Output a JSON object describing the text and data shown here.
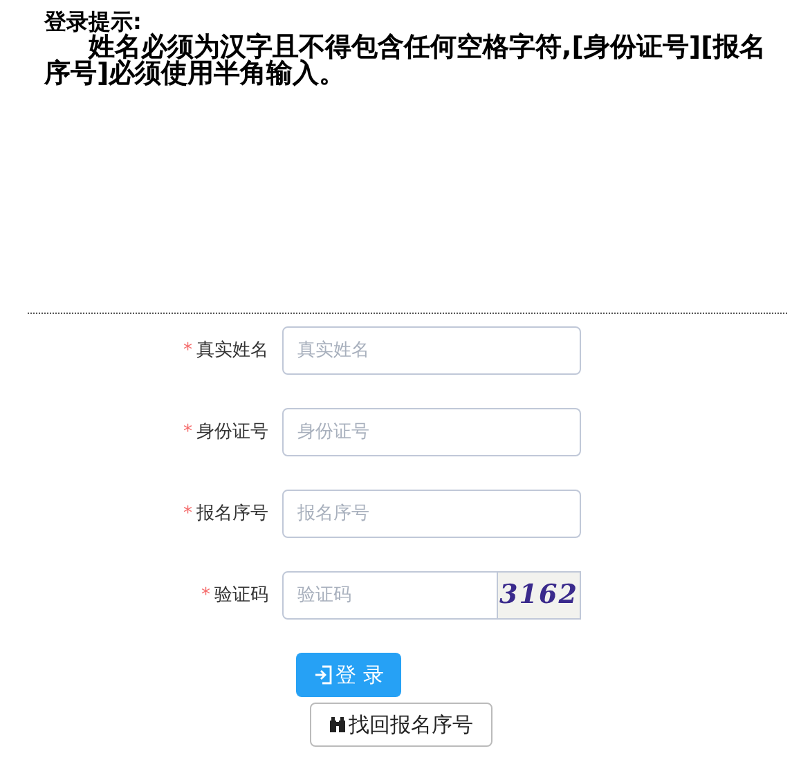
{
  "notice": {
    "title": "登录提示:",
    "body": "姓名必须为汉字且不得包含任何空格字符,[身份证号][报名序号]必须使用半角输入。"
  },
  "fields": [
    {
      "kind": "text",
      "required_mark": "*",
      "label": "真实姓名",
      "placeholder": "真实姓名"
    },
    {
      "kind": "text",
      "required_mark": "*",
      "label": "身份证号",
      "placeholder": "身份证号"
    },
    {
      "kind": "text",
      "required_mark": "*",
      "label": "报名序号",
      "placeholder": "报名序号"
    },
    {
      "kind": "captcha",
      "required_mark": "*",
      "label": "验证码",
      "placeholder": "验证码",
      "code": "3162"
    }
  ],
  "login_button": "登 录",
  "recover_button": "找回报名序号"
}
